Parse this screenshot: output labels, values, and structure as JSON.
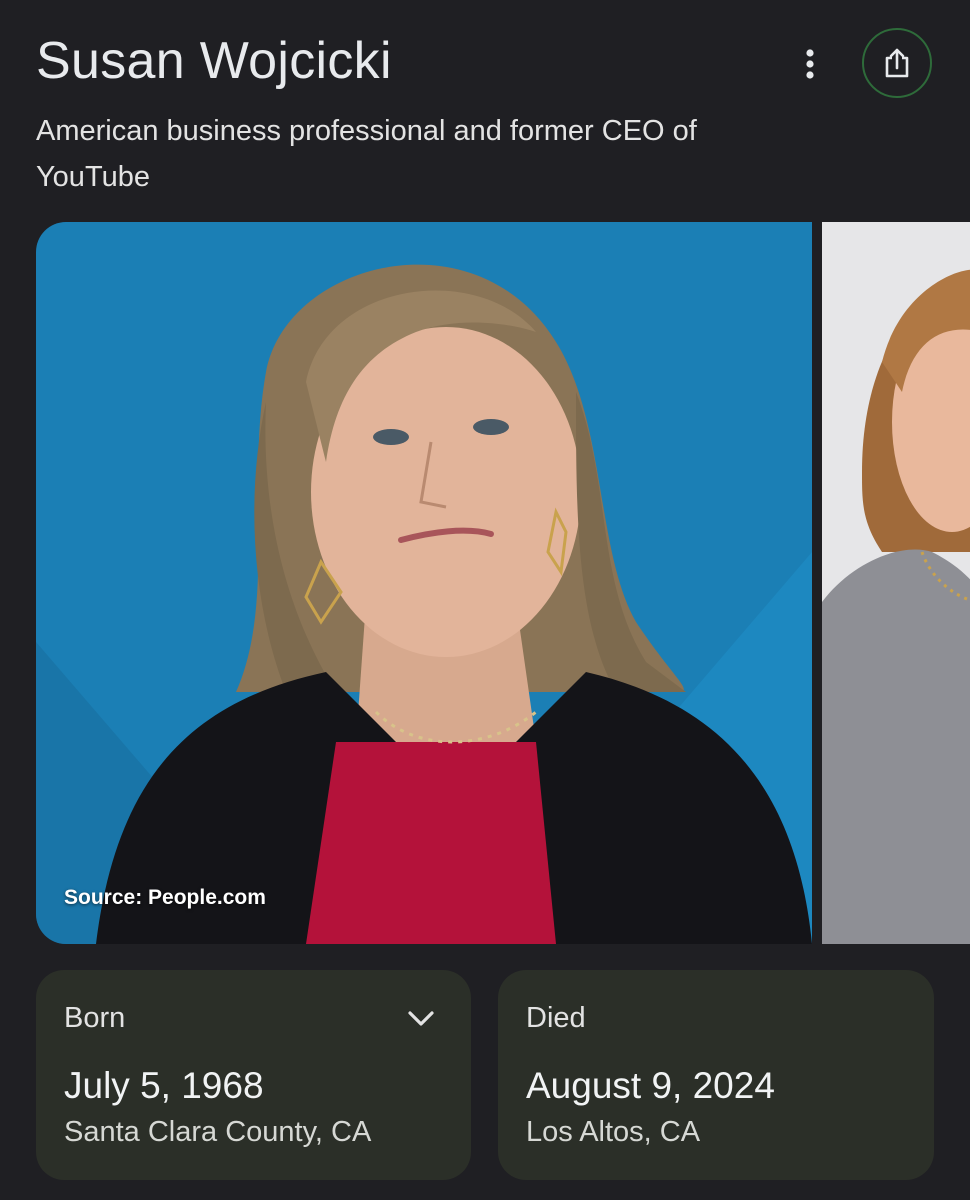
{
  "entity": {
    "name": "Susan Wojcicki",
    "description": "American business professional and former CEO of YouTube"
  },
  "actions": {
    "more_icon": "more-vert-icon",
    "share_icon": "share-icon",
    "share_ring_color": "#2e6b3a"
  },
  "gallery": {
    "main_image_source": "Source: People.com"
  },
  "facts": {
    "born": {
      "label": "Born",
      "date": "July 5, 1968",
      "place": "Santa Clara County, CA"
    },
    "died": {
      "label": "Died",
      "date": "August 9, 2024",
      "place": "Los Altos, CA"
    }
  },
  "colors": {
    "background": "#1f1f23",
    "card": "#2b2f28",
    "photo_backdrop": "#1b7fb5"
  }
}
